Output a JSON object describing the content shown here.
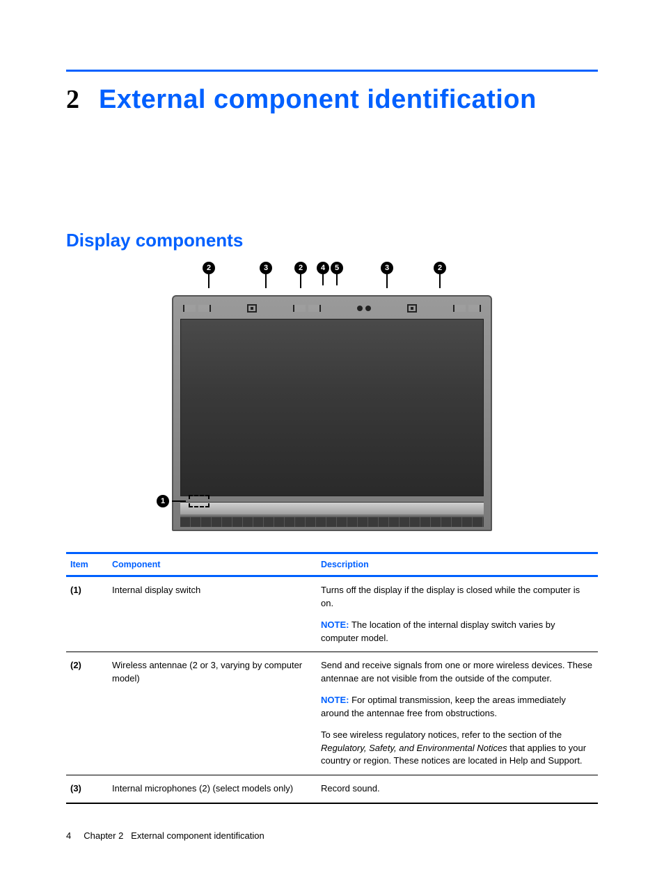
{
  "chapter": {
    "number": "2",
    "title": "External component identification"
  },
  "section": {
    "heading": "Display components"
  },
  "figure": {
    "callouts_top": [
      "2",
      "3",
      "2",
      "4",
      "5",
      "3",
      "2"
    ],
    "callout_side": "1"
  },
  "table": {
    "headers": {
      "item": "Item",
      "component": "Component",
      "description": "Description"
    },
    "note_label": "NOTE:",
    "rows": [
      {
        "item": "(1)",
        "component": "Internal display switch",
        "desc_main": "Turns off the display if the display is closed while the computer is on.",
        "note": "The location of the internal display switch varies by computer model."
      },
      {
        "item": "(2)",
        "component": "Wireless antennae (2 or 3, varying by computer model)",
        "desc_main": "Send and receive signals from one or more wireless devices. These antennae are not visible from the outside of the computer.",
        "note": "For optimal transmission, keep the areas immediately around the antennae free from obstructions.",
        "extra_pre": "To see wireless regulatory notices, refer to the section of the ",
        "extra_italic": "Regulatory, Safety, and Environmental Notices",
        "extra_post": " that applies to your country or region. These notices are located in Help and Support."
      },
      {
        "item": "(3)",
        "component": "Internal microphones (2) (select models only)",
        "desc_main": "Record sound."
      }
    ]
  },
  "footer": {
    "page": "4",
    "chapter_label": "Chapter 2",
    "chapter_title": "External component identification"
  }
}
